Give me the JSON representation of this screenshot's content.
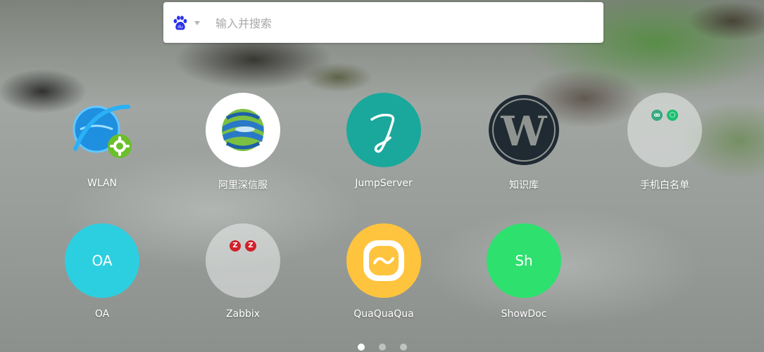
{
  "search": {
    "placeholder": "输入并搜索",
    "value": "",
    "engine_icon": "baidu-paw-icon",
    "engine_color": "#2b32e8"
  },
  "apps": [
    {
      "label": "WLAN",
      "icon": "ie-settings-icon"
    },
    {
      "label": "阿里深信服",
      "icon": "globe-swirl-icon"
    },
    {
      "label": "JumpServer",
      "icon": "jumpserver-logo-icon"
    },
    {
      "label": "知识库",
      "icon": "wordpress-icon"
    },
    {
      "label": "手机白名单",
      "icon": "folder-mini-icons"
    },
    {
      "label": "OA",
      "icon_text": "OA",
      "color": "#2ccfe0"
    },
    {
      "label": "Zabbix",
      "icon": "folder-mini-icons",
      "mini_icons": [
        "Z",
        "Z"
      ]
    },
    {
      "label": "QuaQuaQua",
      "icon": "smile-box-icon",
      "color": "#ffc43d"
    },
    {
      "label": "ShowDoc",
      "icon_text": "Sh",
      "color": "#2ee06e"
    }
  ],
  "pagination": {
    "pages": 3,
    "current": 1
  }
}
